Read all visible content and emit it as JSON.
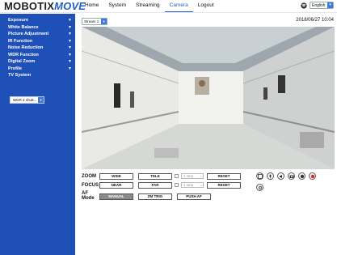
{
  "header": {
    "logo_main": "MOBOTIX",
    "logo_accent": "MOVE",
    "nav": [
      "Home",
      "System",
      "Streaming",
      "Camera",
      "Logout"
    ],
    "active_nav": "Camera",
    "language": "English"
  },
  "sidebar": {
    "items": [
      {
        "label": "Exposure",
        "expandable": true
      },
      {
        "label": "White Balance",
        "expandable": true
      },
      {
        "label": "Picture Adjustment",
        "expandable": true
      },
      {
        "label": "IR Function",
        "expandable": true
      },
      {
        "label": "Noise Reduction",
        "expandable": true
      },
      {
        "label": "WDR Function",
        "expandable": true
      },
      {
        "label": "Digital Zoom",
        "expandable": true
      },
      {
        "label": "Profile",
        "expandable": true
      },
      {
        "label": "TV System",
        "expandable": false
      }
    ],
    "tv_system_value": "WDR 2 shutt..."
  },
  "stream": {
    "selected": "Stream 1",
    "timestamp": "2018/06/27 10:04"
  },
  "controls": {
    "zoom": {
      "label": "ZOOM",
      "wide": "WIDE",
      "tele": "TELE",
      "step": "1 step",
      "reset": "RESET"
    },
    "focus": {
      "label": "FOCUS",
      "near": "NEAR",
      "far": "FAR",
      "step": "1 step",
      "reset": "RESET"
    },
    "af": {
      "label_line1": "AF",
      "label_line2": "Mode",
      "manual": "MANUAL",
      "zm_trig": "ZM TRIG",
      "push_af": "PUSH AF",
      "active_mode": "MANUAL"
    }
  },
  "colors": {
    "sidebar_bg": "#1f50b7",
    "accent": "#1f60c9",
    "record": "#e02020"
  }
}
